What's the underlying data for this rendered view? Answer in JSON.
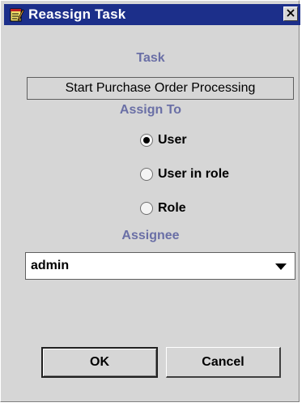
{
  "window": {
    "title": "Reassign Task",
    "icon": "notepad-pencil-icon",
    "close_icon": "close-icon",
    "accent_color": "#1c2f8a",
    "label_color": "#6a6fa6"
  },
  "task": {
    "label": "Task",
    "value": "Start Purchase Order Processing"
  },
  "assign_to": {
    "label": "Assign To",
    "options": [
      {
        "label": "User",
        "selected": true
      },
      {
        "label": "User in role",
        "selected": false
      },
      {
        "label": "Role",
        "selected": false
      }
    ]
  },
  "assignee": {
    "label": "Assignee",
    "selected_value": "admin"
  },
  "buttons": {
    "ok_label": "OK",
    "cancel_label": "Cancel"
  }
}
